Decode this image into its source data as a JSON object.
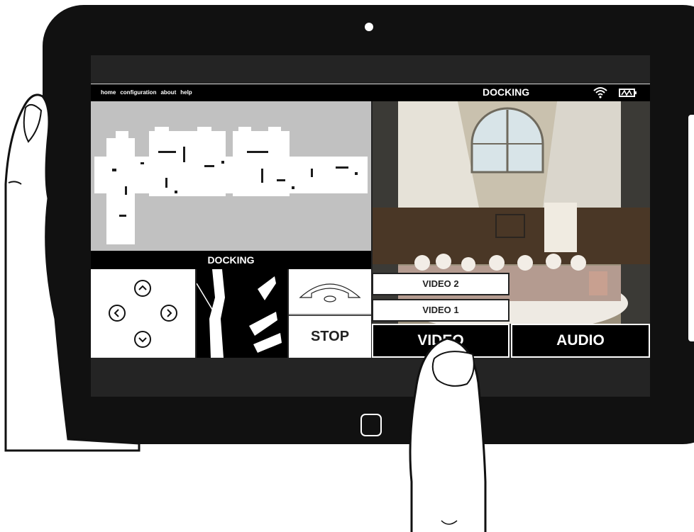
{
  "nav": {
    "links": [
      "home",
      "configuration",
      "about",
      "help"
    ]
  },
  "header": {
    "title": "DOCKING",
    "icons": [
      "wifi-icon",
      "battery-icon"
    ]
  },
  "map_panel": {
    "label": "DOCKING"
  },
  "controls": {
    "stop_label": "STOP",
    "arrows": [
      "up",
      "left",
      "right",
      "down"
    ]
  },
  "video_menu": {
    "items": [
      "VIDEO 2",
      "VIDEO 1"
    ],
    "open": true
  },
  "tabs": {
    "video_label": "VIDEO",
    "audio_label": "AUDIO"
  },
  "colors": {
    "screen_bg": "#242424",
    "map_bg": "#c1c1c1",
    "bar_bg": "#000000",
    "tablet_frame": "#111111"
  }
}
